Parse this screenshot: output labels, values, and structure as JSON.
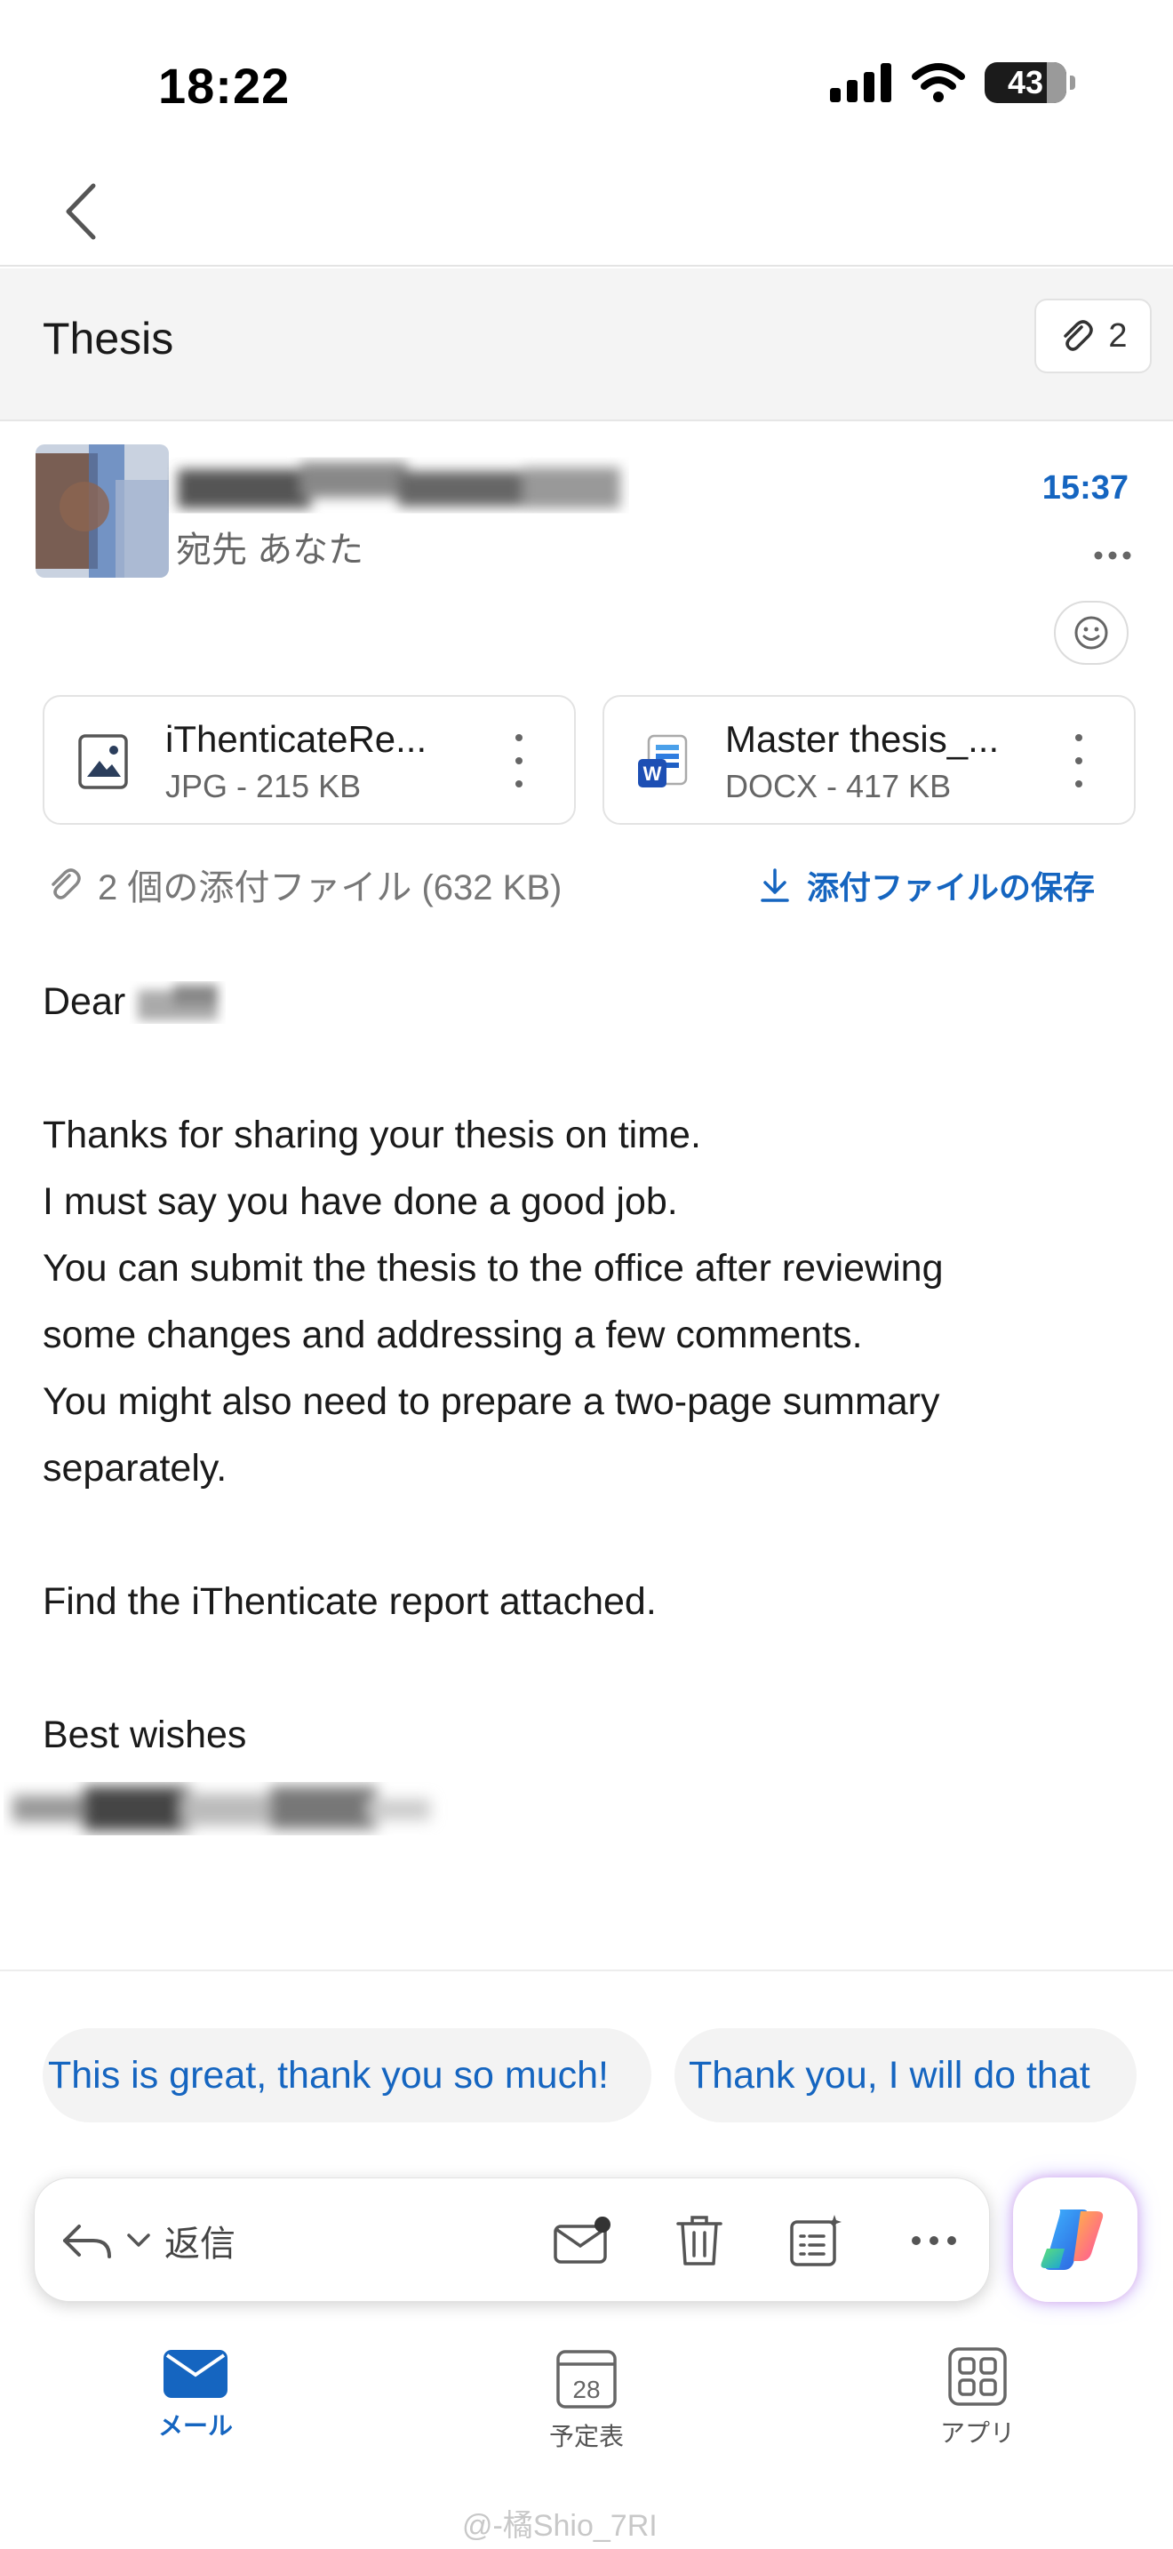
{
  "status_bar": {
    "time": "18:22",
    "battery": "43"
  },
  "header": {
    "subject": "Thesis",
    "attachment_count": "2"
  },
  "sender": {
    "recipient": "宛先 あなた",
    "time": "15:37"
  },
  "attachments": [
    {
      "name": "iThenticateRe...",
      "meta": "JPG - 215 KB",
      "icon": "image-file-icon"
    },
    {
      "name": "Master thesis_...",
      "meta": "DOCX - 417 KB",
      "icon": "word-file-icon"
    }
  ],
  "attachment_summary": "2 個の添付ファイル (632 KB)",
  "save_attachments_label": "添付ファイルの保存",
  "body": {
    "greeting": "Dear",
    "lines": [
      "Thanks for sharing your thesis on time.",
      "I must say you have done a good job.",
      "You can submit the thesis to the office after reviewing",
      "some changes and addressing a few comments.",
      "You might also need to prepare a two-page summary",
      "separately.",
      "Find the iThenticate report attached.",
      "Best wishes"
    ]
  },
  "suggested_replies": [
    "This is great, thank you so much!",
    "Thank you, I will do that"
  ],
  "action_bar": {
    "reply_label": "返信"
  },
  "tabs": [
    {
      "label": "メール",
      "icon": "mail-icon",
      "active": true
    },
    {
      "label": "予定表",
      "icon": "calendar-icon",
      "day": "28"
    },
    {
      "label": "アプリ",
      "icon": "apps-grid-icon"
    }
  ],
  "watermark": "@-橘Shio_7RI",
  "colors": {
    "accent": "#1565c0",
    "subject_bg": "#f4f4f4"
  }
}
